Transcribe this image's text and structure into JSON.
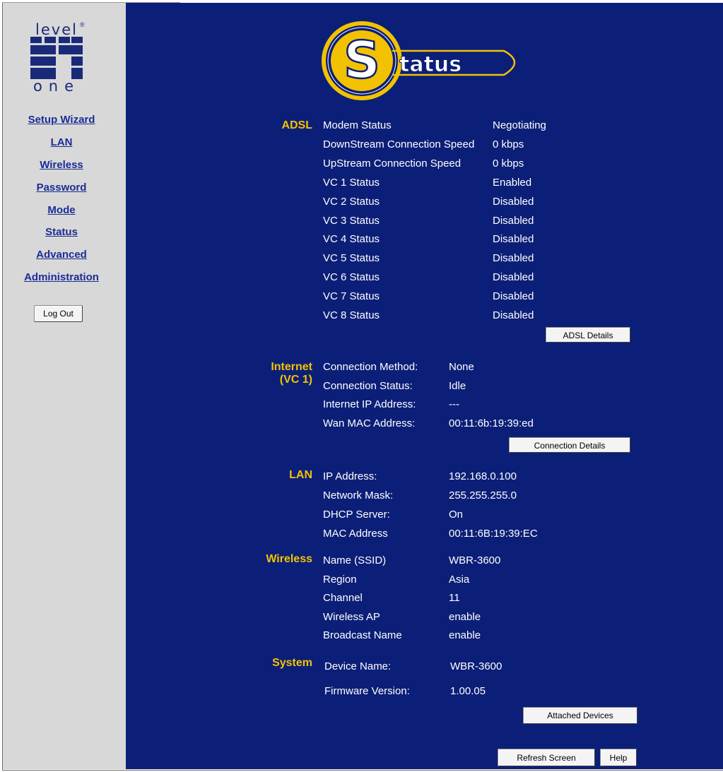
{
  "logo": {
    "top_word": "level",
    "bottom_word": "one",
    "reg_mark": "®"
  },
  "nav": {
    "items": [
      {
        "label": "Setup Wizard"
      },
      {
        "label": "LAN"
      },
      {
        "label": "Wireless"
      },
      {
        "label": "Password"
      },
      {
        "label": "Mode"
      },
      {
        "label": "Status"
      },
      {
        "label": "Advanced"
      },
      {
        "label": "Administration"
      }
    ],
    "logout_label": "Log Out"
  },
  "header": {
    "letter": "S",
    "word": "tatus"
  },
  "adsl": {
    "title": "ADSL",
    "rows": [
      {
        "label": "Modem Status",
        "value": "Negotiating"
      },
      {
        "label": "DownStream Connection Speed",
        "value": "0 kbps"
      },
      {
        "label": "UpStream Connection Speed",
        "value": "0 kbps"
      },
      {
        "label": "VC 1 Status",
        "value": "Enabled"
      },
      {
        "label": "VC 2 Status",
        "value": "Disabled"
      },
      {
        "label": "VC 3 Status",
        "value": "Disabled"
      },
      {
        "label": "VC 4 Status",
        "value": "Disabled"
      },
      {
        "label": "VC 5 Status",
        "value": "Disabled"
      },
      {
        "label": "VC 6 Status",
        "value": "Disabled"
      },
      {
        "label": "VC 7 Status",
        "value": "Disabled"
      },
      {
        "label": "VC 8 Status",
        "value": "Disabled"
      }
    ],
    "details_button": "ADSL Details"
  },
  "internet": {
    "title_line1": "Internet",
    "title_line2": "(VC 1)",
    "rows": [
      {
        "label": "Connection Method:",
        "value": "None"
      },
      {
        "label": "Connection Status:",
        "value": "Idle"
      },
      {
        "label": "Internet IP Address:",
        "value": "---"
      },
      {
        "label": "Wan MAC Address:",
        "value": "00:11:6b:19:39:ed"
      }
    ],
    "details_button": "Connection Details"
  },
  "lan": {
    "title": "LAN",
    "rows": [
      {
        "label": "IP Address:",
        "value": "192.168.0.100"
      },
      {
        "label": "Network Mask:",
        "value": "255.255.255.0"
      },
      {
        "label": "DHCP Server:",
        "value": "On"
      },
      {
        "label": "MAC Address",
        "value": "00:11:6B:19:39:EC"
      }
    ]
  },
  "wireless": {
    "title": "Wireless",
    "rows": [
      {
        "label": "Name (SSID)",
        "value": "WBR-3600"
      },
      {
        "label": "Region",
        "value": "Asia"
      },
      {
        "label": "Channel",
        "value": "11"
      },
      {
        "label": "Wireless AP",
        "value": "enable"
      },
      {
        "label": "Broadcast Name",
        "value": "enable"
      }
    ]
  },
  "system": {
    "title": "System",
    "rows": [
      {
        "label": "Device Name:",
        "value": "WBR-3600"
      },
      {
        "label": "Firmware Version:",
        "value": "1.00.05"
      }
    ],
    "attached_button": "Attached Devices"
  },
  "footer": {
    "refresh_button": "Refresh Screen",
    "help_button": "Help"
  },
  "colors": {
    "main_bg": "#0c1f78",
    "sidebar_bg": "#d8d8d8",
    "section_title": "#f4c200",
    "nav_link": "#1a2d96"
  }
}
